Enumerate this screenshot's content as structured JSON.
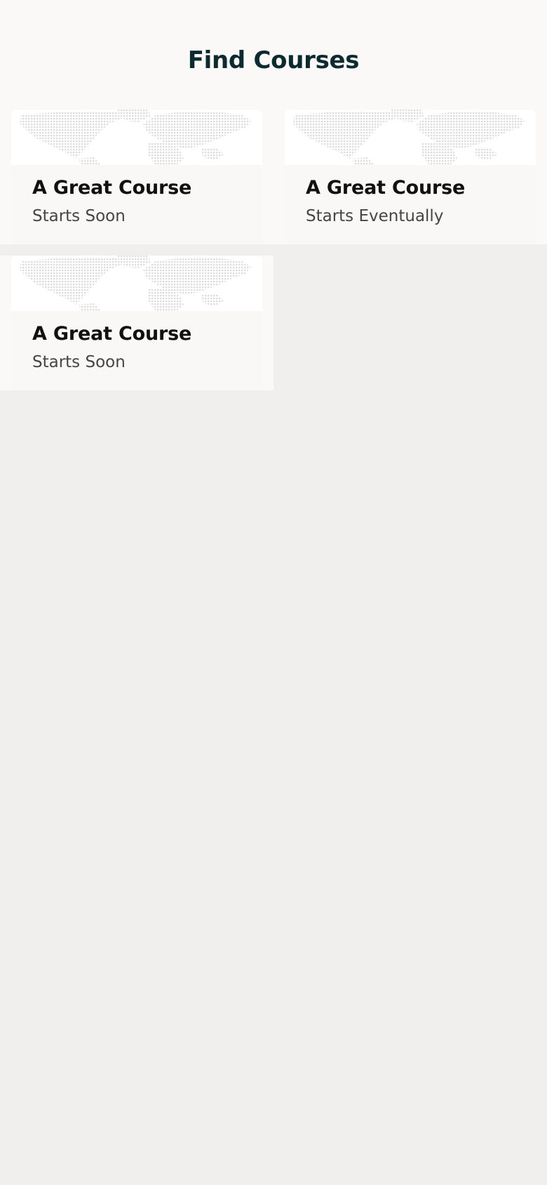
{
  "page": {
    "title": "Find Courses"
  },
  "courses": [
    {
      "title": "A Great Course",
      "subtitle": "Starts Soon",
      "image_icon": "world-map-icon"
    },
    {
      "title": "A Great Course",
      "subtitle": "Starts Eventually",
      "image_icon": "world-map-icon"
    },
    {
      "title": "A Great Course",
      "subtitle": "Starts Soon",
      "image_icon": "world-map-icon"
    }
  ],
  "colors": {
    "page_background": "#f0efed",
    "header_background": "#faf9f8",
    "title_text": "#0d2a31",
    "card_title_text": "#111111",
    "card_subtitle_text": "#454545"
  }
}
